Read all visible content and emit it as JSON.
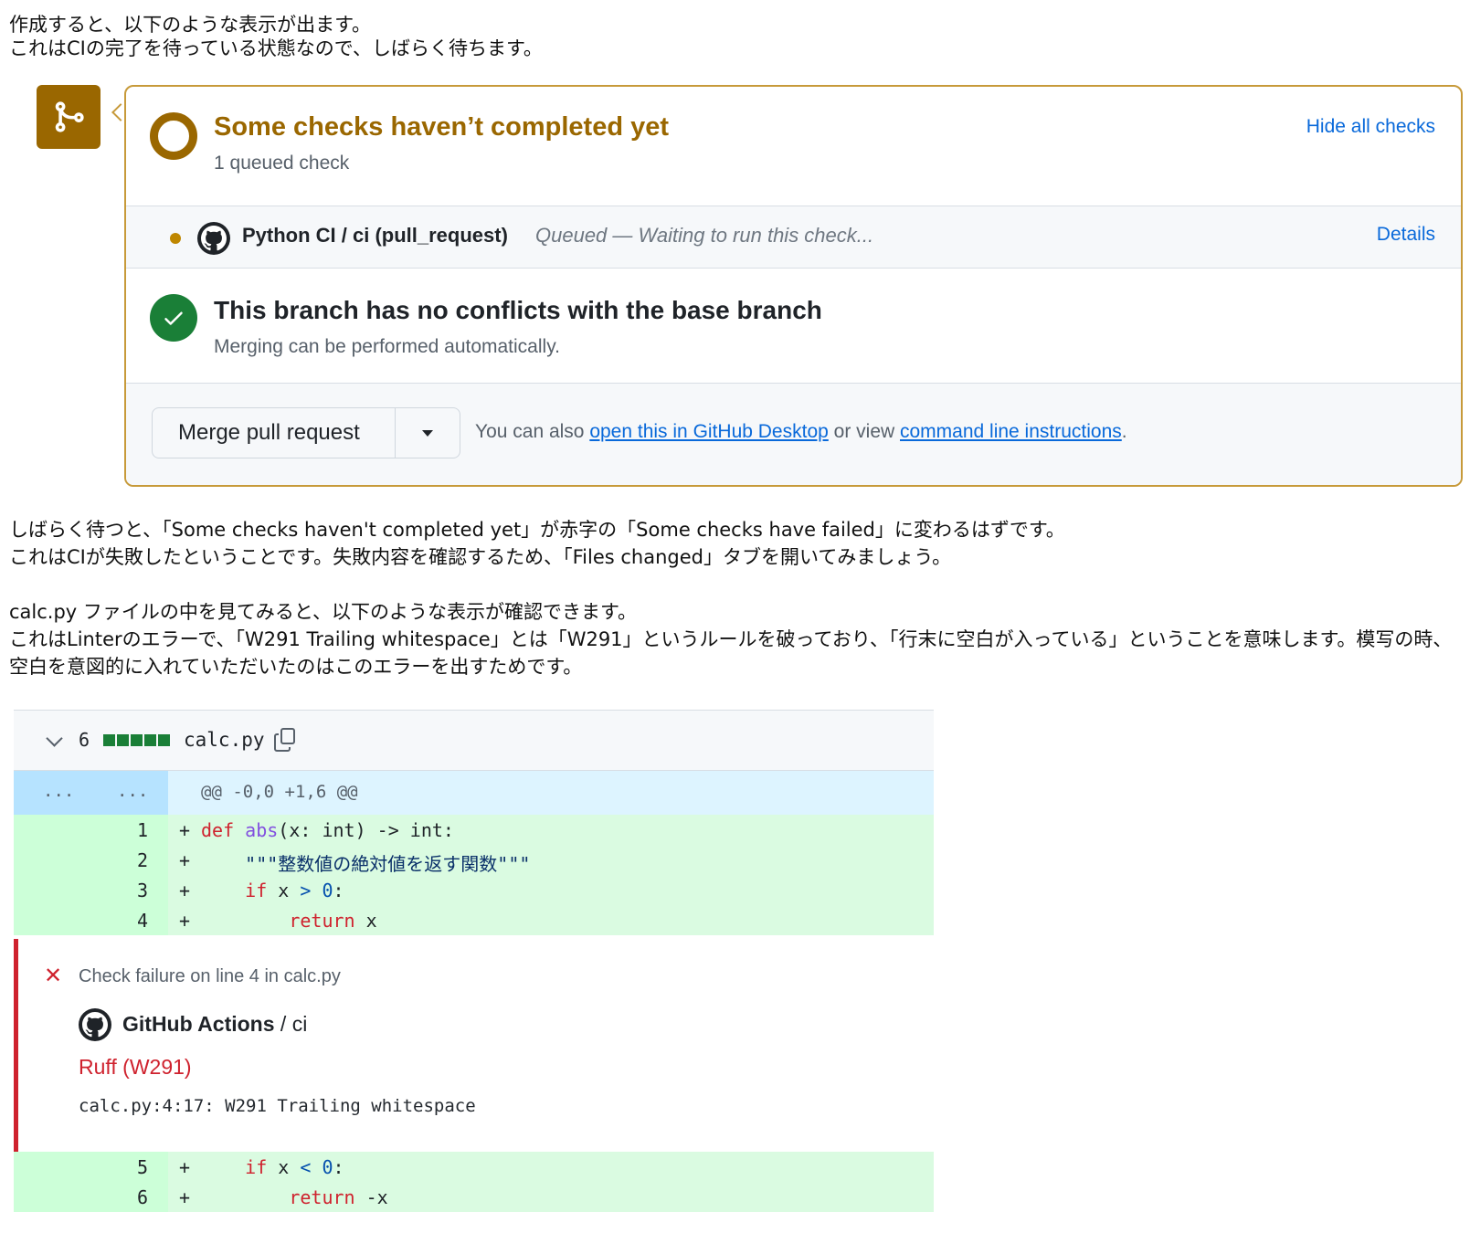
{
  "intro": {
    "line1": "作成すると、以下のような表示が出ます。",
    "line2": "これはCIの完了を待っている状態なので、しばらく待ちます。"
  },
  "merge_box": {
    "title": "Some checks haven’t completed yet",
    "subtitle": "1 queued check",
    "hide_link": "Hide all checks",
    "check": {
      "name": "Python CI / ci (pull_request)",
      "status": "Queued — Waiting to run this check...",
      "details_link": "Details"
    },
    "branch": {
      "title": "This branch has no conflicts with the base branch",
      "subtitle": "Merging can be performed automatically."
    },
    "merge_button": "Merge pull request",
    "also_text_1": "You can also ",
    "desktop_link": "open this in GitHub Desktop",
    "also_text_2": " or view ",
    "cli_link": "command line instructions",
    "also_text_3": ".",
    "colors": {
      "pending": "#9a6700",
      "success": "#1a7f37",
      "link": "#0969da"
    },
    "icons": [
      "git-merge-icon",
      "pending-ring-icon",
      "github-logo-icon",
      "check-icon",
      "caret-down-icon"
    ]
  },
  "para2": {
    "line1": "しばらく待つと、「Some checks haven't completed yet」が赤字の「Some checks have failed」に変わるはずです。",
    "line2": "これはCIが失敗したということです。失敗内容を確認するため、「Files changed」タブを開いてみましょう。"
  },
  "para3": {
    "line1": "calc.py ファイルの中を見てみると、以下のような表示が確認できます。",
    "line2": "これはLinterのエラーで、「W291 Trailing whitespace」とは「W291」というルールを破っており、「行末に空白が入っている」ということを意味します。模写の時、空白を意図的に入れていただいたのはこのエラーを出すためです。"
  },
  "diff": {
    "change_count": "6",
    "file_name": "calc.py",
    "hunk_left": "...",
    "hunk_right": "...",
    "hunk_header": "@@ -0,0 +1,6 @@",
    "lines": [
      {
        "num": "1",
        "sign": "+",
        "kw": "def",
        "fn": "abs",
        "rest": "(x: int) -> int:"
      },
      {
        "num": "2",
        "sign": "+",
        "indent": "    ",
        "str": "\"\"\"整数値の絶対値を返す関数\"\"\""
      },
      {
        "num": "3",
        "sign": "+",
        "indent": "    ",
        "kw": "if",
        "pre": " x ",
        "op": ">",
        "sp": " ",
        "numlit": "0",
        "post": ":"
      },
      {
        "num": "4",
        "sign": "+",
        "indent": "        ",
        "kw": "return",
        "pre": " x"
      },
      {
        "num": "5",
        "sign": "+",
        "indent": "    ",
        "kw": "if",
        "pre": " x ",
        "op": "<",
        "sp": " ",
        "numlit": "0",
        "post": ":"
      },
      {
        "num": "6",
        "sign": "+",
        "indent": "        ",
        "kw": "return",
        "pre": " -x"
      }
    ],
    "annotation": {
      "title": "Check failure on line 4 in calc.py",
      "app": "GitHub Actions",
      "app_suffix": " / ci",
      "rule": "Ruff (W291)",
      "message": "calc.py:4:17: W291 Trailing whitespace"
    }
  }
}
